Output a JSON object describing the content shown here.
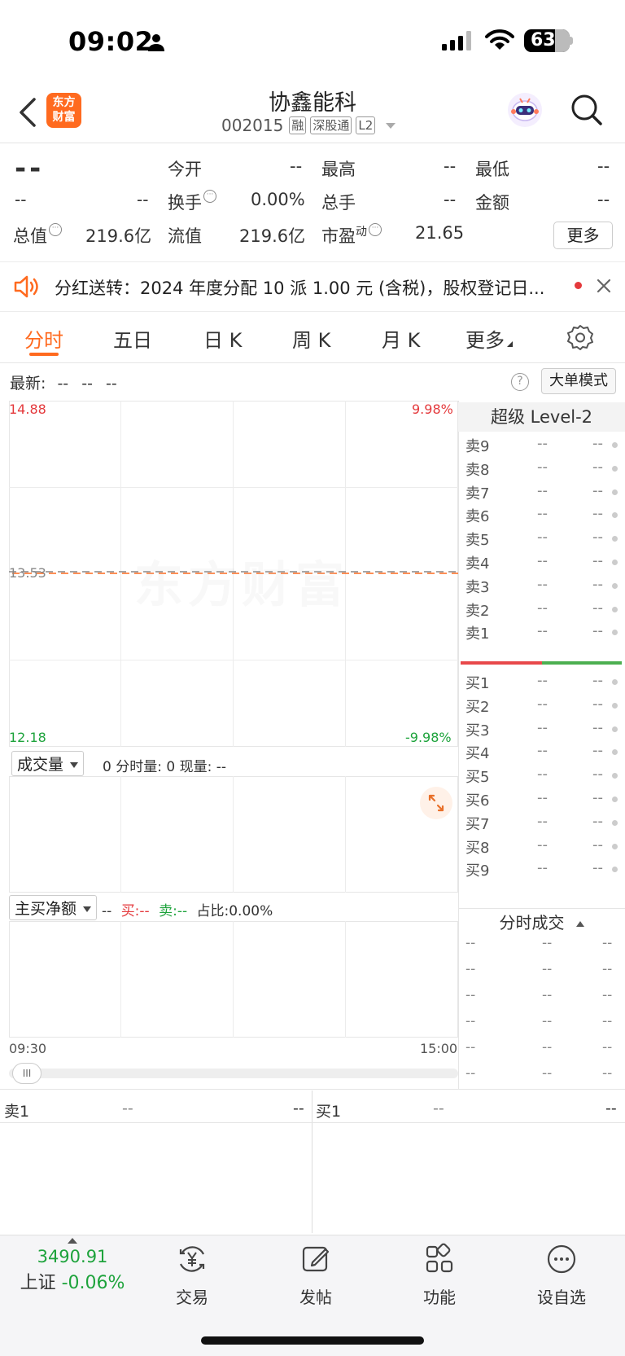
{
  "status_bar": {
    "time": "09:02",
    "battery": "63"
  },
  "header": {
    "logo": "东方财富",
    "stock_name": "协鑫能科",
    "stock_code": "002015",
    "tags": [
      "融",
      "深股通",
      "L2"
    ]
  },
  "quote": {
    "price": "--",
    "change": "--",
    "change_pct": "--",
    "fields": [
      {
        "label": "今开",
        "value": "--"
      },
      {
        "label": "最高",
        "value": "--"
      },
      {
        "label": "最低",
        "value": "--"
      },
      {
        "label": "换手",
        "value": "0.00%"
      },
      {
        "label": "总手",
        "value": "--"
      },
      {
        "label": "金额",
        "value": "--"
      },
      {
        "label": "总值",
        "value": "219.6亿"
      },
      {
        "label": "流值",
        "value": "219.6亿"
      },
      {
        "label": "市盈",
        "sup": "动",
        "value": "21.65"
      }
    ],
    "more_label": "更多"
  },
  "notice": {
    "text": "分红送转：2024 年度分配 10 派 1.00 元 (含税)，股权登记日..."
  },
  "tabs": [
    "分时",
    "五日",
    "日 K",
    "周 K",
    "月 K",
    "更多"
  ],
  "chart": {
    "latest_label": "最新:",
    "latest_values": [
      "--",
      "--",
      "--"
    ],
    "big_order_label": "大单模式",
    "help_symbol": "?",
    "price_high": "14.88",
    "price_mid": "13.53",
    "price_low": "12.18",
    "pct_high": "9.98%",
    "pct_low": "-9.98%",
    "watermark": "东方财富",
    "time_start": "09:30",
    "time_end": "15:00",
    "volume_label": "成交量",
    "volume_info": "0 分时量: 0 现量: --",
    "netflow_label": "主买净额",
    "netflow_value": "--",
    "netflow_buy": "买:--",
    "netflow_sell": "卖:--",
    "netflow_ratio": "占比:0.00%",
    "scroll_handle": "III"
  },
  "level2": {
    "title": "超级 Level-2",
    "sell": [
      {
        "k": "卖9",
        "p": "--",
        "v": "--"
      },
      {
        "k": "卖8",
        "p": "--",
        "v": "--"
      },
      {
        "k": "卖7",
        "p": "--",
        "v": "--"
      },
      {
        "k": "卖6",
        "p": "--",
        "v": "--"
      },
      {
        "k": "卖5",
        "p": "--",
        "v": "--"
      },
      {
        "k": "卖4",
        "p": "--",
        "v": "--"
      },
      {
        "k": "卖3",
        "p": "--",
        "v": "--"
      },
      {
        "k": "卖2",
        "p": "--",
        "v": "--"
      },
      {
        "k": "卖1",
        "p": "--",
        "v": "--"
      }
    ],
    "buy": [
      {
        "k": "买1",
        "p": "--",
        "v": "--"
      },
      {
        "k": "买2",
        "p": "--",
        "v": "--"
      },
      {
        "k": "买3",
        "p": "--",
        "v": "--"
      },
      {
        "k": "买4",
        "p": "--",
        "v": "--"
      },
      {
        "k": "买5",
        "p": "--",
        "v": "--"
      },
      {
        "k": "买6",
        "p": "--",
        "v": "--"
      },
      {
        "k": "买7",
        "p": "--",
        "v": "--"
      },
      {
        "k": "买8",
        "p": "--",
        "v": "--"
      },
      {
        "k": "买9",
        "p": "--",
        "v": "--"
      }
    ],
    "ticks_title": "分时成交",
    "ticks": [
      [
        "--",
        "--",
        "--"
      ],
      [
        "--",
        "--",
        "--"
      ],
      [
        "--",
        "--",
        "--"
      ],
      [
        "--",
        "--",
        "--"
      ],
      [
        "--",
        "--",
        "--"
      ],
      [
        "--",
        "--",
        "--"
      ]
    ]
  },
  "bottom_book": {
    "sell_label": "卖1",
    "sell_price": "--",
    "sell_vol": "--",
    "buy_label": "买1",
    "buy_price": "--",
    "buy_vol": "--"
  },
  "nav": {
    "index_value": "3490.91",
    "index_name": "上证",
    "index_change": "-0.06%",
    "items": [
      "交易",
      "发帖",
      "功能",
      "设自选"
    ]
  }
}
